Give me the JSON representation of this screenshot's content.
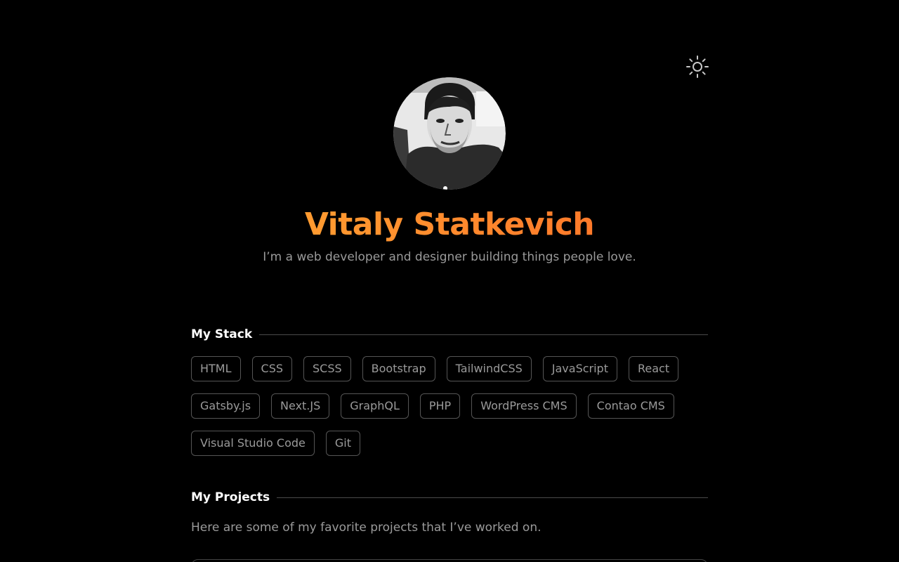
{
  "theme_toggle": {
    "icon": "sun-icon",
    "color": "#c8c8c8"
  },
  "hero": {
    "name": "Vitaly Statkevich",
    "tagline": "I’m a web developer and designer building things people love.",
    "name_gradient": [
      "#ff9b30",
      "#ff7a2a"
    ]
  },
  "stack": {
    "title": "My Stack",
    "items": [
      "HTML",
      "CSS",
      "SCSS",
      "Bootstrap",
      "TailwindCSS",
      "JavaScript",
      "React",
      "Gatsby.js",
      "Next.JS",
      "GraphQL",
      "PHP",
      "WordPress CMS",
      "Contao CMS",
      "Visual Studio Code",
      "Git"
    ]
  },
  "projects": {
    "title": "My Projects",
    "description": "Here are some of my favorite projects that I’ve worked on."
  },
  "colors": {
    "background": "#000000",
    "text_muted": "#9a9a9a",
    "heading": "#ffffff",
    "accent": "#ff8a2c",
    "border": "#555555"
  }
}
